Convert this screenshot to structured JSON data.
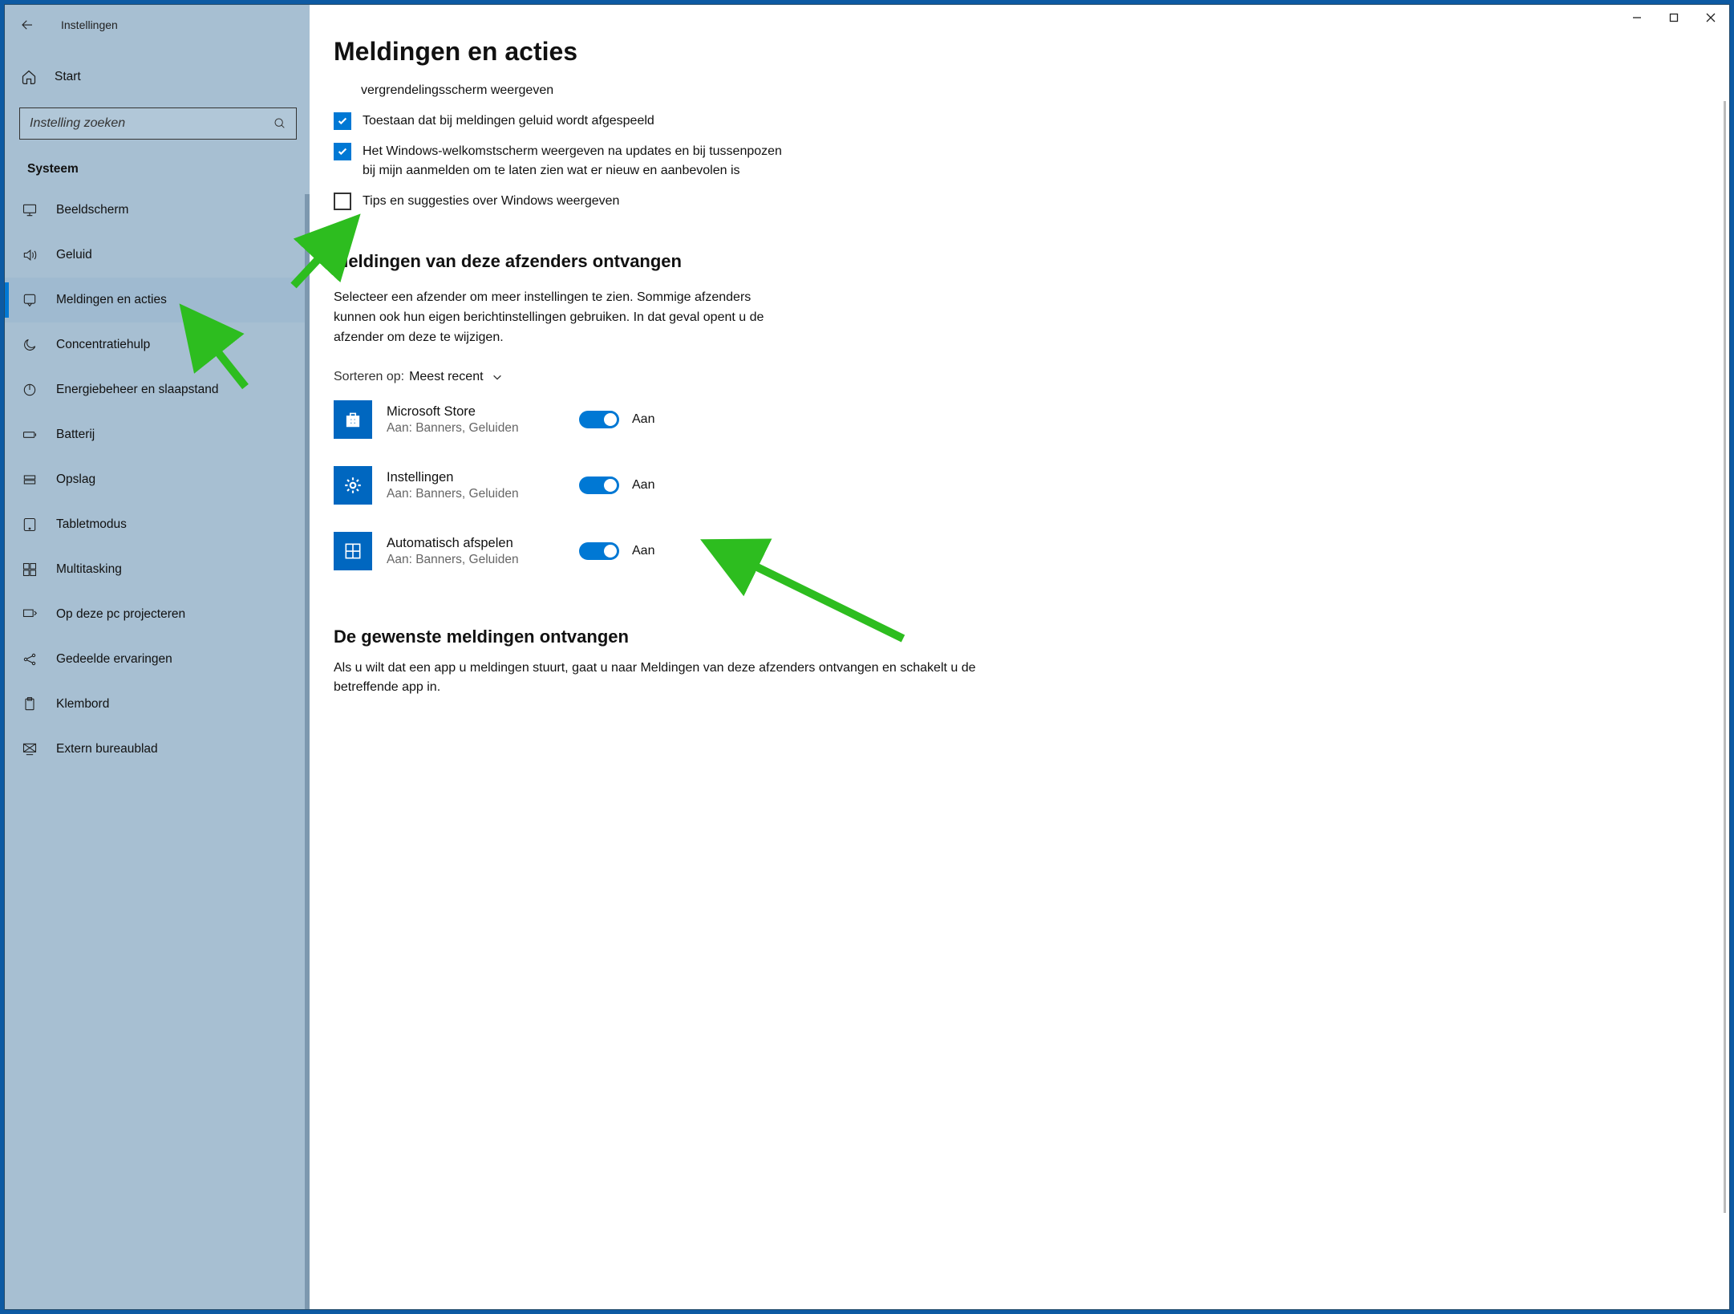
{
  "app": {
    "title": "Instellingen"
  },
  "home": {
    "label": "Start"
  },
  "search": {
    "placeholder": "Instelling zoeken"
  },
  "sidebar": {
    "section": "Systeem",
    "items": [
      {
        "label": "Beeldscherm",
        "icon": "display"
      },
      {
        "label": "Geluid",
        "icon": "sound"
      },
      {
        "label": "Meldingen en acties",
        "icon": "notify",
        "active": true
      },
      {
        "label": "Concentratiehulp",
        "icon": "moon"
      },
      {
        "label": "Energiebeheer en slaapstand",
        "icon": "power"
      },
      {
        "label": "Batterij",
        "icon": "battery"
      },
      {
        "label": "Opslag",
        "icon": "storage"
      },
      {
        "label": "Tabletmodus",
        "icon": "tablet"
      },
      {
        "label": "Multitasking",
        "icon": "multi"
      },
      {
        "label": "Op deze pc projecteren",
        "icon": "project"
      },
      {
        "label": "Gedeelde ervaringen",
        "icon": "share"
      },
      {
        "label": "Klembord",
        "icon": "clipboard"
      },
      {
        "label": "Extern bureaublad",
        "icon": "remote"
      }
    ]
  },
  "page": {
    "title": "Meldingen en acties",
    "checks": [
      {
        "checked": true,
        "label": "vergrendelingsscherm weergeven",
        "partial": true
      },
      {
        "checked": true,
        "label": "Toestaan dat bij meldingen geluid wordt afgespeeld"
      },
      {
        "checked": true,
        "label": "Het Windows-welkomstscherm weergeven na updates en bij tussenpozen bij mijn aanmelden om te laten zien wat er nieuw en aanbevolen is"
      },
      {
        "checked": false,
        "label": "Tips en suggesties over Windows weergeven"
      }
    ],
    "sendersHeading": "Meldingen van deze afzenders ontvangen",
    "sendersDesc": "Selecteer een afzender om meer instellingen te zien. Sommige afzenders kunnen ook hun eigen berichtinstellingen gebruiken. In dat geval opent u de afzender om deze te wijzigen.",
    "sortLabel": "Sorteren op:",
    "sortValue": "Meest recent",
    "senders": [
      {
        "title": "Microsoft Store",
        "sub": "Aan: Banners, Geluiden",
        "state": "Aan",
        "icon": "store"
      },
      {
        "title": "Instellingen",
        "sub": "Aan: Banners, Geluiden",
        "state": "Aan",
        "icon": "gear"
      },
      {
        "title": "Automatisch afspelen",
        "sub": "Aan: Banners, Geluiden",
        "state": "Aan",
        "icon": "autoplay"
      }
    ],
    "desiredHeading": "De gewenste meldingen ontvangen",
    "desiredDesc": "Als u wilt dat een app u meldingen stuurt, gaat u naar Meldingen van deze afzenders ontvangen en schakelt u de betreffende app in."
  }
}
